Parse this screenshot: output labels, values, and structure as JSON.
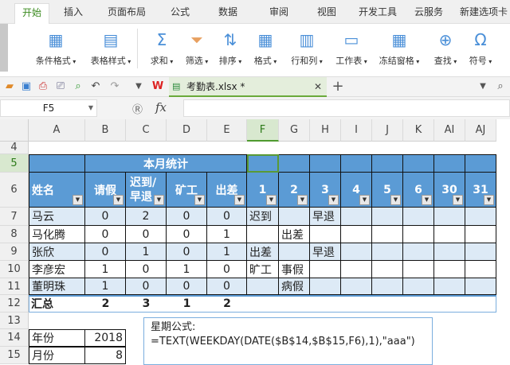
{
  "tabs": [
    "开始",
    "插入",
    "页面布局",
    "公式",
    "数据",
    "审阅",
    "视图",
    "开发工具",
    "云服务",
    "新建选项卡"
  ],
  "ribbon": [
    {
      "label": "条件格式",
      "icon": "conditional-format-icon"
    },
    {
      "label": "表格样式",
      "icon": "table-style-icon"
    },
    {
      "label": "求和",
      "icon": "sum-icon"
    },
    {
      "label": "筛选",
      "icon": "filter-icon"
    },
    {
      "label": "排序",
      "icon": "sort-icon"
    },
    {
      "label": "格式",
      "icon": "format-icon"
    },
    {
      "label": "行和列",
      "icon": "rows-cols-icon"
    },
    {
      "label": "工作表",
      "icon": "worksheet-icon"
    },
    {
      "label": "冻结窗格",
      "icon": "freeze-panes-icon"
    },
    {
      "label": "查找",
      "icon": "find-icon"
    },
    {
      "label": "符号",
      "icon": "symbol-icon"
    }
  ],
  "doc_tab": "考勤表.xlsx *",
  "name_box": "F5",
  "fx": "fx",
  "columns": [
    "A",
    "B",
    "C",
    "D",
    "E",
    "F",
    "G",
    "H",
    "I",
    "J",
    "K",
    "AI",
    "AJ"
  ],
  "row_numbers": [
    "4",
    "5",
    "6",
    "7",
    "8",
    "9",
    "10",
    "11",
    "12",
    "13",
    "14",
    "15"
  ],
  "title": "本月统计",
  "headers": [
    "姓名",
    "请假",
    "迟到/早退",
    "矿工",
    "出差",
    "1",
    "2",
    "3",
    "4",
    "5",
    "6",
    "30",
    "31"
  ],
  "rows": [
    [
      "马云",
      "0",
      "2",
      "0",
      "0",
      "迟到",
      "",
      "早退"
    ],
    [
      "马化腾",
      "0",
      "0",
      "0",
      "1",
      "",
      "出差",
      ""
    ],
    [
      "张欣",
      "0",
      "1",
      "0",
      "1",
      "出差",
      "",
      "早退"
    ],
    [
      "李彦宏",
      "1",
      "0",
      "1",
      "0",
      "旷工",
      "事假",
      ""
    ],
    [
      "董明珠",
      "1",
      "0",
      "0",
      "0",
      "",
      "病假",
      ""
    ]
  ],
  "total": [
    "汇总",
    "2",
    "3",
    "1",
    "2"
  ],
  "params": [
    [
      "年份",
      "2018"
    ],
    [
      "月份",
      "8"
    ]
  ],
  "note": {
    "title": "星期公式:",
    "formula": "=TEXT(WEEKDAY(DATE($B$14,$B$15,F6),1),\"aaa\")"
  }
}
